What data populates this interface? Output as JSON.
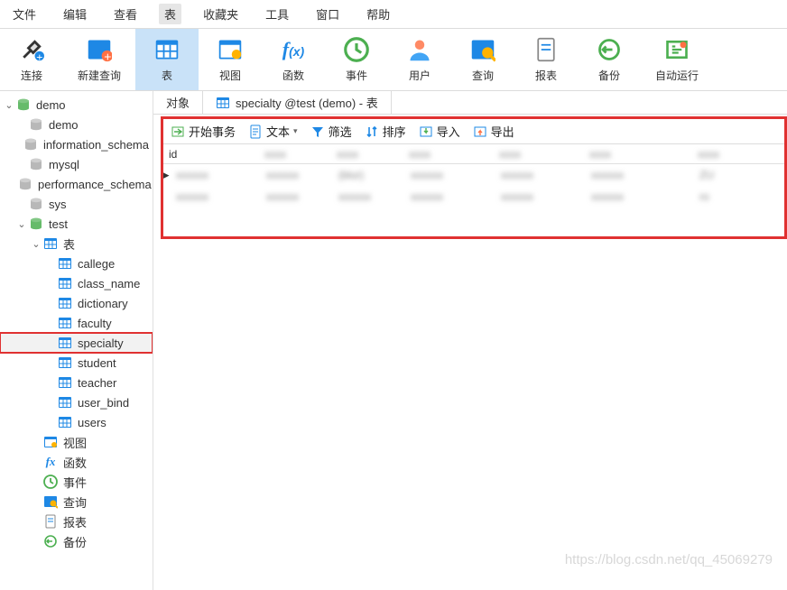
{
  "menu": [
    "文件",
    "编辑",
    "查看",
    "表",
    "收藏夹",
    "工具",
    "窗口",
    "帮助"
  ],
  "menu_active_index": 3,
  "bigbar": [
    {
      "label": "连接",
      "icon": "plug"
    },
    {
      "label": "新建查询",
      "icon": "newquery"
    },
    {
      "label": "表",
      "icon": "table",
      "selected": true
    },
    {
      "label": "视图",
      "icon": "view"
    },
    {
      "label": "函数",
      "icon": "fx"
    },
    {
      "label": "事件",
      "icon": "clock"
    },
    {
      "label": "用户",
      "icon": "user"
    },
    {
      "label": "查询",
      "icon": "query"
    },
    {
      "label": "报表",
      "icon": "report"
    },
    {
      "label": "备份",
      "icon": "backup"
    },
    {
      "label": "自动运行",
      "icon": "auto"
    }
  ],
  "tree": {
    "root": {
      "label": "demo",
      "expanded": true
    },
    "databases": [
      "demo",
      "information_schema",
      "mysql",
      "performance_schema",
      "sys"
    ],
    "active_db": "test",
    "tables_label": "表",
    "tables": [
      "callege",
      "class_name",
      "dictionary",
      "faculty",
      "specialty",
      "student",
      "teacher",
      "user_bind",
      "users"
    ],
    "selected_table_index": 4,
    "other_nodes": [
      {
        "label": "视图",
        "icon": "view"
      },
      {
        "label": "函数",
        "icon": "fx"
      },
      {
        "label": "事件",
        "icon": "clock"
      },
      {
        "label": "查询",
        "icon": "query"
      },
      {
        "label": "报表",
        "icon": "report"
      },
      {
        "label": "备份",
        "icon": "backup"
      }
    ]
  },
  "tabs": [
    {
      "label": "对象",
      "icon": null
    },
    {
      "label": "specialty @test (demo) - 表",
      "icon": "table",
      "active": true
    }
  ],
  "toolbar2": [
    {
      "label": "开始事务",
      "icon": "tx"
    },
    {
      "label": "文本",
      "icon": "doc",
      "dropdown": true
    },
    {
      "label": "筛选",
      "icon": "filter"
    },
    {
      "label": "排序",
      "icon": "sort"
    },
    {
      "label": "导入",
      "icon": "import"
    },
    {
      "label": "导出",
      "icon": "export"
    }
  ],
  "grid": {
    "columns": [
      "id",
      "",
      "",
      "",
      "",
      "",
      ""
    ],
    "rows": [
      {
        "selected": true,
        "cells": [
          "",
          "",
          "(blur)",
          "",
          "",
          "",
          "ZU"
        ]
      },
      {
        "cells": [
          "",
          "",
          "",
          "",
          "",
          "",
          "ro"
        ]
      }
    ]
  },
  "watermark": "https://blog.csdn.net/qq_45069279"
}
